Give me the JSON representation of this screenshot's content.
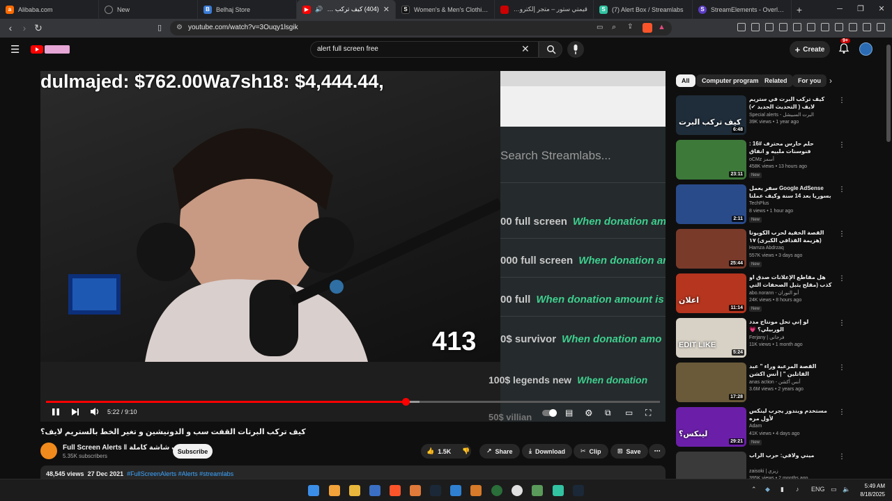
{
  "browser": {
    "tabs": [
      {
        "title": "Alibaba.com",
        "icon": "alibaba-icon",
        "color": "#ff6a00"
      },
      {
        "title": "New",
        "icon": "circle-icon",
        "color": "#888888"
      },
      {
        "title": "Belhaj Store",
        "icon": "store-icon",
        "color": "#3a7bd5"
      },
      {
        "title": "(404) كيف تركب البرتات",
        "icon": "youtube-icon",
        "color": "#ff0000",
        "active": true
      },
      {
        "title": "Women's & Men's Clothing, Sh",
        "icon": "shein-icon",
        "color": "#111111"
      },
      {
        "title": "قيمتي ستور – متجر إلكتروني متك",
        "icon": "store-icon",
        "color": "#cc0000"
      },
      {
        "title": "(7) Alert Box / Streamlabs",
        "icon": "streamlabs-icon",
        "color": "#31c3a2"
      },
      {
        "title": "StreamElements - Overlays",
        "icon": "streamelements-icon",
        "color": "#5b3cc4"
      }
    ],
    "url": "youtube.com/watch?v=3Ouqy1lsgik"
  },
  "youtube": {
    "search_value": "alert full screen free",
    "create_label": "Create",
    "notification_count": "9+"
  },
  "video": {
    "overlay_top": "dulmajed: $762.00Wa7sh18: $4,444.44,",
    "cam_number": "413",
    "panel_search": "Search Streamlabs...",
    "panel_rows": [
      {
        "a": "00 full screen",
        "b": "When donation amo"
      },
      {
        "a": "000 full screen",
        "b": "When donation amoun"
      },
      {
        "a": "00 full",
        "b": "When donation amount is"
      },
      {
        "a": "0$ survivor",
        "b": "When donation amo"
      }
    ],
    "low_row": {
      "a": "100$ legends new",
      "b": "When donation"
    },
    "low_row_2": "50$ villian",
    "time": "5:22 / 9:10",
    "progress": 0.586
  },
  "details": {
    "title": "كيف تركب البرتات القفت سب و الدونيشين و تغير الخط بالستريم لايف؟",
    "channel": "Full Screen Alerts ‖ البرتات شاشة كاملة",
    "subscribers": "5.35K subscribers",
    "subscribe_label": "Subscribe",
    "likes": "1.5K",
    "share_label": "Share",
    "download_label": "Download",
    "clip_label": "Clip",
    "save_label": "Save",
    "views": "48,545 views",
    "date": "27 Dec 2021",
    "tags": "#FullScreenAlerts #Alerts #streamlabs"
  },
  "sidebar": {
    "chips": [
      "All",
      "Computer program",
      "Related",
      "For you"
    ],
    "recs": [
      {
        "title": "كيف تركب البرت في ستريم لايف ( التحديث الجديد ✔)",
        "channel": "Special alerts - البرت السبيشل",
        "meta": "39K views • 1 year ago",
        "duration": "6:48",
        "thumb_text": "كيف تركب البرت",
        "thumb_color": "#1f2d3a",
        "new": ""
      },
      {
        "title": "حلم حارس محترف #16 : فنوسنات ملبيه و انفاق",
        "channel": "oCMz أسمز",
        "meta": "458K views • 13 hours ago",
        "duration": "23:11",
        "thumb_text": "",
        "thumb_color": "#3d7a3a",
        "new": "New"
      },
      {
        "title": "Google AdSense سفر يعمل بسوريا بعد 14 سنة وكيف عملنا أرباحك من اليوتيوب؟",
        "channel": "TechPlus",
        "meta": "8 views • 1 hour ago",
        "duration": "2:11",
        "thumb_text": "",
        "thumb_color": "#2a4b8a",
        "new": "New"
      },
      {
        "title": "القصة الخفية لحرب الكويوتا (هزيمة القذافي الكبرى) ١٧",
        "channel": "Hamza Abdrzaq",
        "meta": "557K views • 3 days ago",
        "duration": "25:44",
        "thumb_text": "",
        "thumb_color": "#7a3a2a",
        "new": "New"
      },
      {
        "title": "هل مقاطع الإعلانات صدق او كذب (مقلح يثبل الصحفات التي في السياره)",
        "channel": "abo.norann - أبو النوران",
        "meta": "24K views • 8 hours ago",
        "duration": "11:14",
        "thumb_text": "اعلان",
        "thumb_color": "#b5351f",
        "new": "New"
      },
      {
        "title": "لو إني تحل مونتاج مدد الوربيلي؟ 💗",
        "channel": "Ferjany | فرجاني",
        "meta": "11K views • 1 month ago",
        "duration": "5:24",
        "thumb_text": "EDIT LIKE",
        "thumb_color": "#d8d2c6",
        "new": ""
      },
      {
        "title": "القصة المرعبة وراء \" عبد القاتلين \" | أنس اكشن",
        "channel": "anas action - أنس أكشن",
        "meta": "3.6M views • 2 years ago",
        "duration": "17:28",
        "thumb_text": "",
        "thumb_color": "#6a5a3a",
        "new": ""
      },
      {
        "title": "مستخدم ويندوز يجرب لينكس لأول مره",
        "channel": "Adam",
        "meta": "41K views • 4 days ago",
        "duration": "29:21",
        "thumb_text": "لينكس؟",
        "thumb_color": "#6b1fa8",
        "new": "New"
      },
      {
        "title": "ميني ولاقي: حرب الراب",
        "channel": "zaisoki | زيزي",
        "meta": "395K views • 2 months ago",
        "duration": "",
        "thumb_text": "",
        "thumb_color": "#3a3a3a",
        "new": ""
      }
    ]
  },
  "taskbar": {
    "lang": "ENG",
    "time": "5:49 AM",
    "date": "8/18/2025"
  }
}
